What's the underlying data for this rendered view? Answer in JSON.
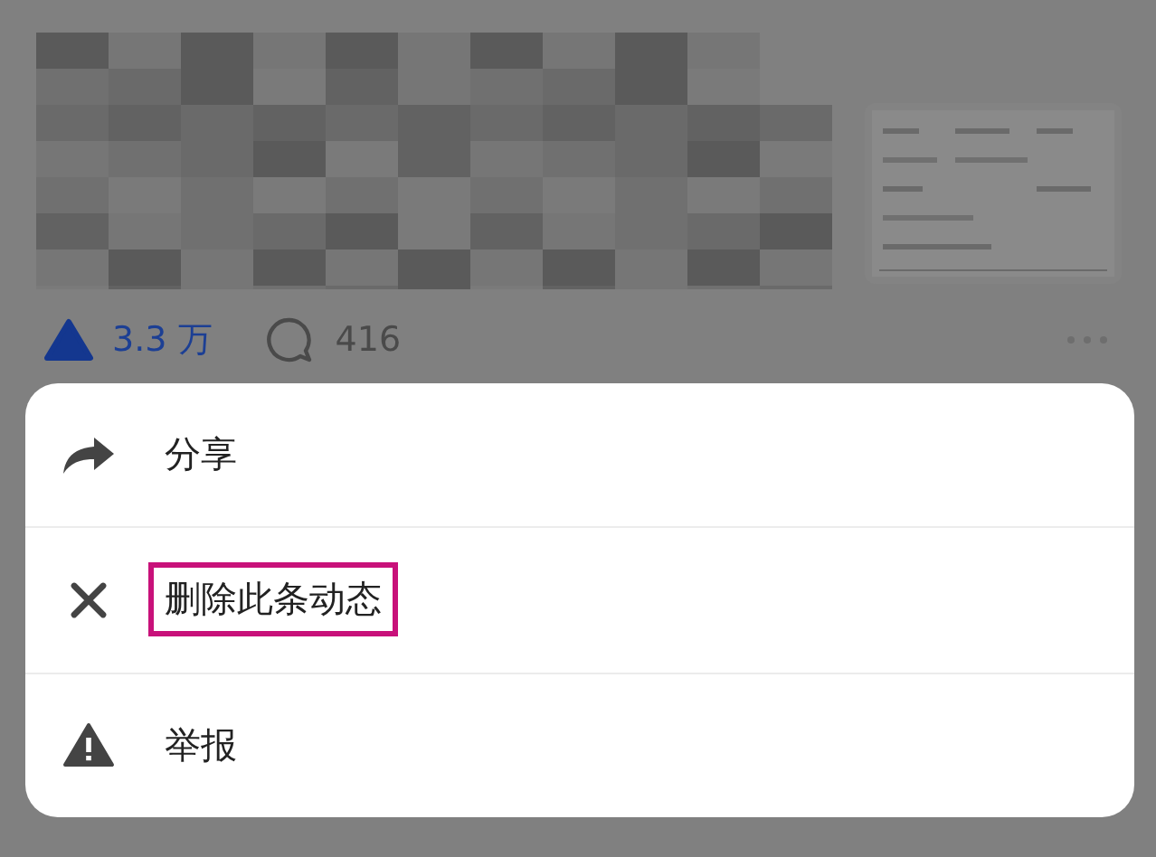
{
  "post": {
    "stats": {
      "likes": "3.3 万",
      "comments": "416"
    }
  },
  "action_sheet": {
    "items": [
      {
        "kind": "share",
        "label": "分享",
        "highlighted": false
      },
      {
        "kind": "delete",
        "label": "删除此条动态",
        "highlighted": true
      },
      {
        "kind": "report",
        "label": "举报",
        "highlighted": false
      }
    ]
  }
}
